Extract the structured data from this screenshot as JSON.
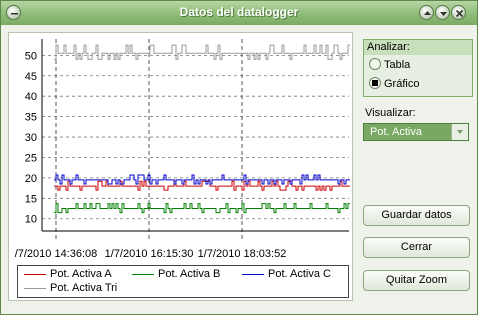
{
  "window": {
    "title": "Datos del datalogger"
  },
  "chart_data": {
    "type": "line",
    "x_tick_labels": [
      "/7/2010 14:36:08",
      "1/7/2010 16:15:30",
      "1/7/2010 18:03:52"
    ],
    "y_ticks": [
      10,
      15,
      20,
      25,
      30,
      35,
      40,
      45,
      50
    ],
    "ylim": [
      7,
      54
    ],
    "grid": true,
    "legend_placement": "bottom",
    "series": [
      {
        "name": "Pot. Activa A",
        "color": "#cc0000",
        "approx_level": 18
      },
      {
        "name": "Pot. Activa B",
        "color": "#008000",
        "approx_level": 12.5
      },
      {
        "name": "Pot. Activa C",
        "color": "#0000cc",
        "approx_level": 19.5
      },
      {
        "name": "Pot. Activa Tri",
        "color": "#999999",
        "approx_level": 50.5
      }
    ]
  },
  "sidebar": {
    "analyze_title": "Analizar:",
    "option_table": "Tabla",
    "option_chart": "Gráfico",
    "selected_option": "Gráfico",
    "visualize_label": "Visualizar:",
    "visualize_value": "Pot. Activa"
  },
  "buttons": {
    "save": "Guardar datos",
    "close": "Cerrar",
    "reset_zoom": "Quitar Zoom"
  }
}
